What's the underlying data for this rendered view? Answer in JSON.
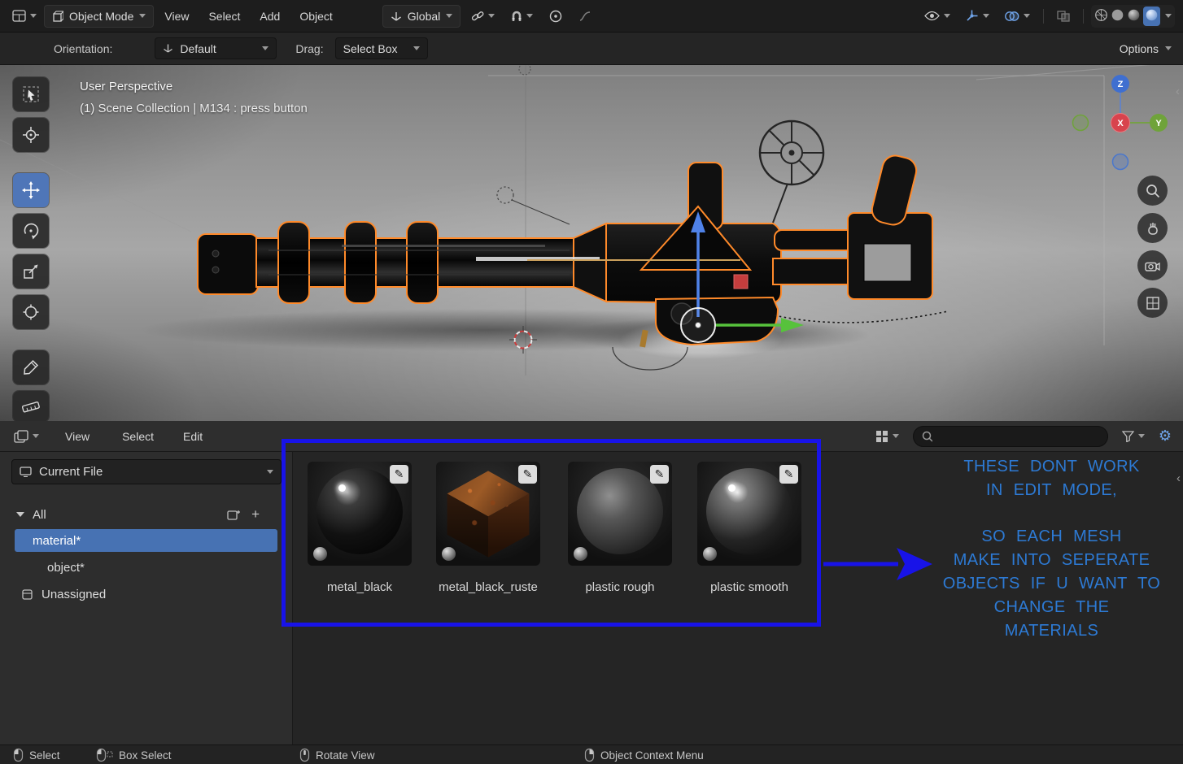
{
  "topbar": {
    "mode_label": "Object Mode",
    "menus": [
      "View",
      "Select",
      "Add",
      "Object"
    ],
    "orientation_value": "Global"
  },
  "tool_settings": {
    "orientation_label": "Orientation:",
    "orientation_value": "Default",
    "drag_label": "Drag:",
    "drag_value": "Select Box",
    "options_label": "Options"
  },
  "viewport": {
    "perspective_label": "User Perspective",
    "breadcrumb": "(1) Scene Collection | M134 : press button",
    "axes": {
      "x": "X",
      "y": "Y",
      "z": "Z"
    }
  },
  "asset_browser": {
    "menus": [
      "View",
      "Select",
      "Edit"
    ],
    "source_value": "Current File",
    "tree": {
      "all_label": "All",
      "items": [
        "material*",
        "object*",
        "Unassigned"
      ]
    },
    "materials": [
      "metal_black",
      "metal_black_ruste",
      "plastic rough",
      "plastic smooth"
    ]
  },
  "annotation": {
    "line1": "THESE DONT WORK",
    "line2": "IN EDIT MODE,",
    "line3": "SO EACH MESH",
    "line4": "MAKE INTO SEPERATE",
    "line5": "OBJECTS IF U WANT TO",
    "line6": "CHANGE THE",
    "line7": "MATERIALS"
  },
  "colors": {
    "selection_accent": "#4772b3",
    "annotation_box": "#1813e8",
    "annotation_text": "#2d7ad4",
    "selected_outline": "#ff8a2a"
  },
  "statusbar": {
    "items": [
      "Select",
      "Box Select",
      "Rotate View",
      "Object Context Menu"
    ]
  }
}
